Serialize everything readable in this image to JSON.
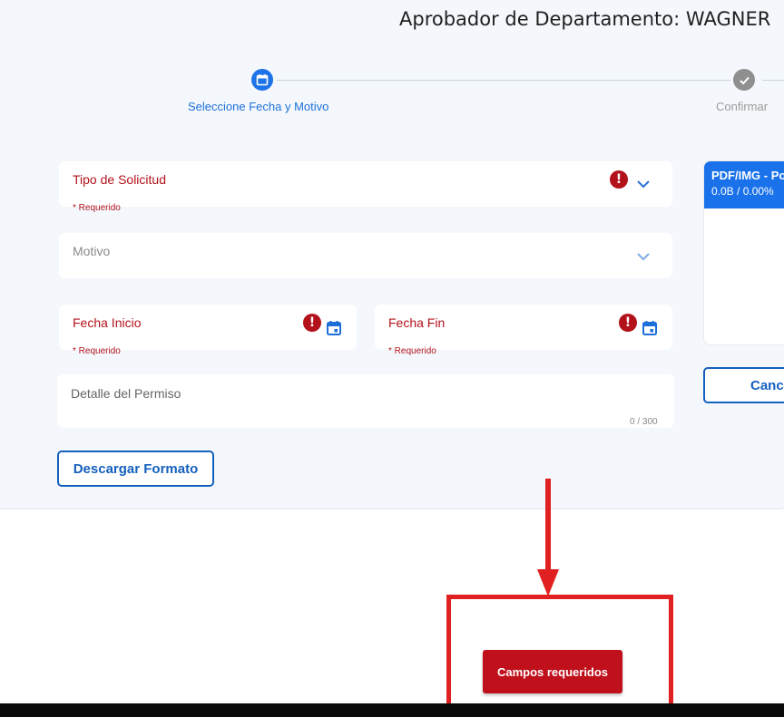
{
  "header": {
    "approver": "Aprobador de Departamento: WAGNER"
  },
  "stepper": {
    "steps": [
      {
        "label": "Seleccione Fecha y Motivo",
        "icon": "calendar-icon",
        "state": "active"
      },
      {
        "label": "Confirmar",
        "icon": "check-icon",
        "state": "pending"
      }
    ]
  },
  "form": {
    "tipo_solicitud": {
      "label": "Tipo de Solicitud",
      "helper": "* Requerido",
      "value": ""
    },
    "motivo": {
      "label": "Motivo",
      "value": ""
    },
    "fecha_inicio": {
      "label": "Fecha Inicio",
      "helper": "* Requerido",
      "value": ""
    },
    "fecha_fin": {
      "label": "Fecha Fin",
      "helper": "* Requerido",
      "value": ""
    },
    "detalle": {
      "label": "Detalle del Permiso",
      "counter": "0 / 300",
      "value": ""
    },
    "download_button": "Descargar Formato"
  },
  "upload": {
    "title": "PDF/IMG - Po",
    "size": "0.0B / 0.00%",
    "cancel_button": "Canc"
  },
  "footer": {
    "required_button": "Campos requeridos"
  },
  "colors": {
    "primary": "#1e73e8",
    "error": "#b3121b",
    "annotation": "#e12121",
    "panel": "#f4f8fc"
  }
}
